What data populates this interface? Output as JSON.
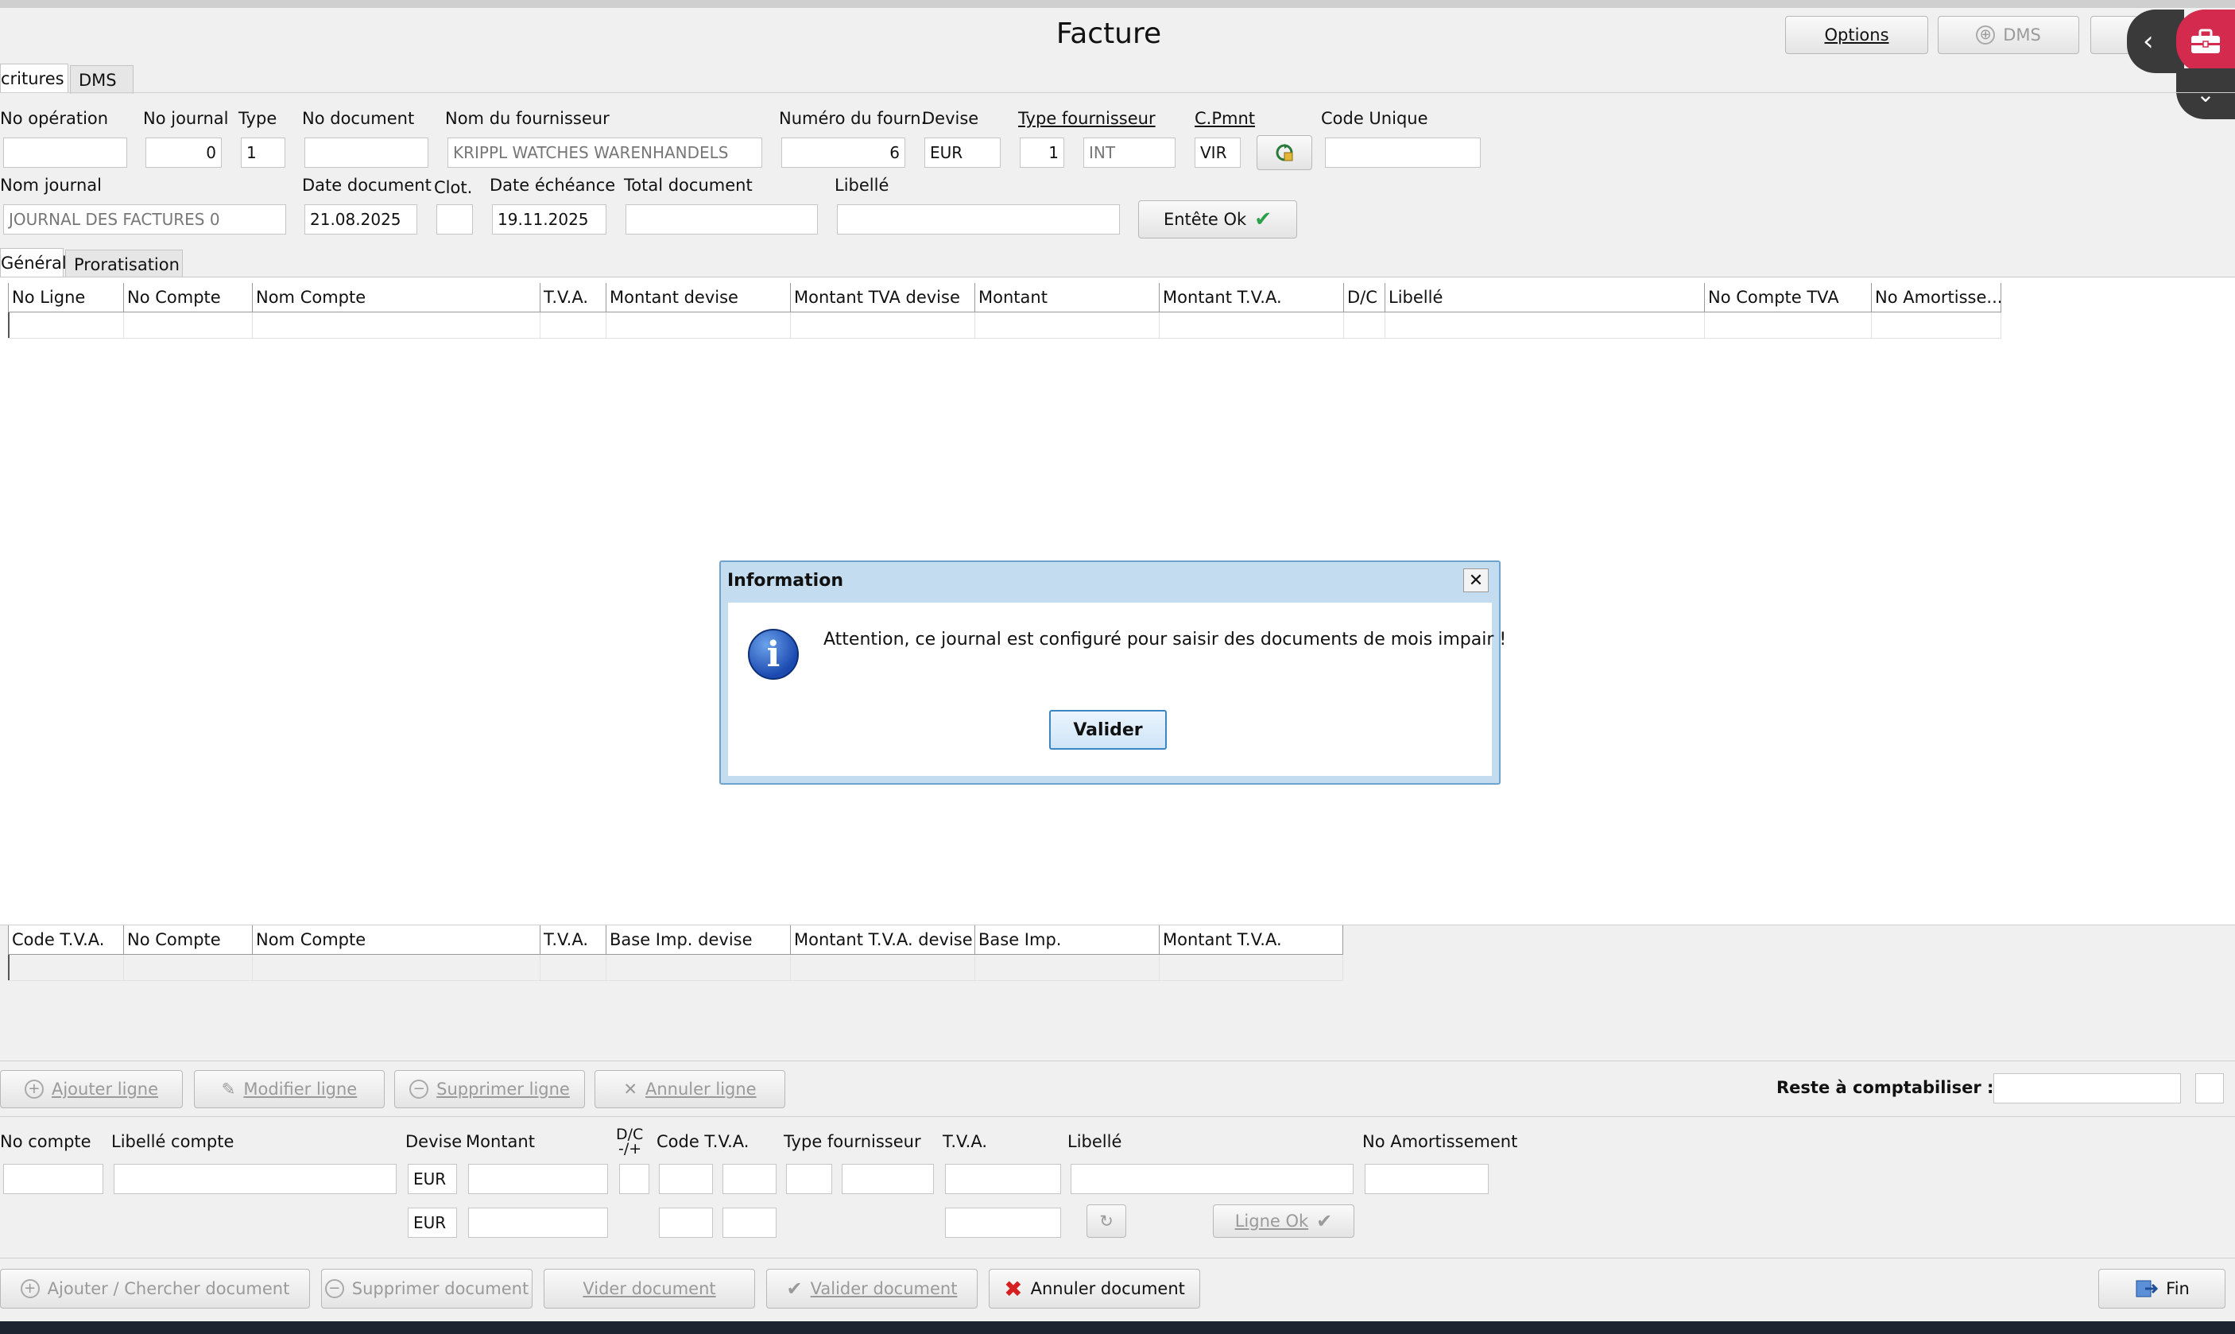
{
  "window": {
    "title": "Facture",
    "options_label": "Options",
    "dms_label": "DMS"
  },
  "top_tabs": {
    "ecritures": "critures",
    "dms": "DMS"
  },
  "header": {
    "row1_labels": {
      "no_operation": "No opération",
      "no_journal": "No journal",
      "type": "Type",
      "no_document": "No document",
      "nom_fournisseur": "Nom du fournisseur",
      "numero_fourn": "Numéro du fourn.",
      "devise": "Devise",
      "type_fournisseur": "Type fournisseur",
      "cpmnt": "C.Pmnt",
      "code_unique": "Code Unique"
    },
    "row1_values": {
      "no_operation": "",
      "no_journal": "0",
      "type": "1",
      "no_document": "",
      "nom_fournisseur": "KRIPPL WATCHES WARENHANDELS",
      "numero_fourn": "6",
      "devise": "EUR",
      "type_fourn_num": "1",
      "type_fourn_code": "INT",
      "cpmnt": "VIR",
      "code_unique": ""
    },
    "row2_labels": {
      "nom_journal": "Nom journal",
      "date_document": "Date document",
      "clot": "Clot.",
      "date_echeance": "Date échéance",
      "total_document": "Total document",
      "libelle": "Libellé"
    },
    "row2_values": {
      "nom_journal": "JOURNAL DES FACTURES 0",
      "date_document": "21.08.2025",
      "clot": "",
      "date_echeance": "19.11.2025",
      "total_document": "",
      "libelle": ""
    },
    "entete_ok": "Entête Ok"
  },
  "inner_tabs": {
    "general": "Général",
    "proratisation": "Proratisation"
  },
  "lines_table": {
    "columns": [
      "No Ligne",
      "No Compte",
      "Nom Compte",
      "T.V.A.",
      "Montant devise",
      "Montant TVA devise",
      "Montant",
      "Montant T.V.A.",
      "D/C",
      "Libellé",
      "No Compte TVA",
      "No Amortisse..."
    ]
  },
  "vat_table": {
    "columns": [
      "Code T.V.A.",
      "No Compte",
      "Nom Compte",
      "T.V.A.",
      "Base Imp. devise",
      "Montant T.V.A. devise",
      "Base Imp.",
      "Montant T.V.A."
    ]
  },
  "line_actions": {
    "ajouter": "Ajouter ligne",
    "modifier": "Modifier ligne",
    "supprimer": "Supprimer ligne",
    "annuler": "Annuler ligne",
    "reste_label": "Reste à comptabiliser :",
    "reste_value": ""
  },
  "entry": {
    "labels": {
      "no_compte": "No compte",
      "libelle_compte": "Libellé compte",
      "devise": "Devise",
      "montant": "Montant",
      "dc": "D/C",
      "dc_sub": "-/+",
      "code_tva": "Code T.V.A.",
      "type_fournisseur": "Type fournisseur",
      "tva": "T.V.A.",
      "libelle": "Libellé",
      "no_amortissement": "No Amortissement"
    },
    "devise1": "EUR",
    "devise2": "EUR",
    "ligne_ok": "Ligne Ok"
  },
  "doc_actions": {
    "ajouter_chercher": "Ajouter / Chercher document",
    "supprimer": "Supprimer document",
    "vider": "Vider document",
    "valider": "Valider document",
    "annuler": "Annuler document",
    "fin": "Fin"
  },
  "dialog": {
    "title": "Information",
    "message": "Attention, ce journal est configuré pour saisir des documents de mois impair !",
    "button": "Valider",
    "icon": "info-icon"
  },
  "colors": {
    "dialog_frame": "#c4dcf0",
    "accent_red": "#d42a4d",
    "ok_green": "#2aa04a",
    "cancel_red": "#d61f1f"
  }
}
